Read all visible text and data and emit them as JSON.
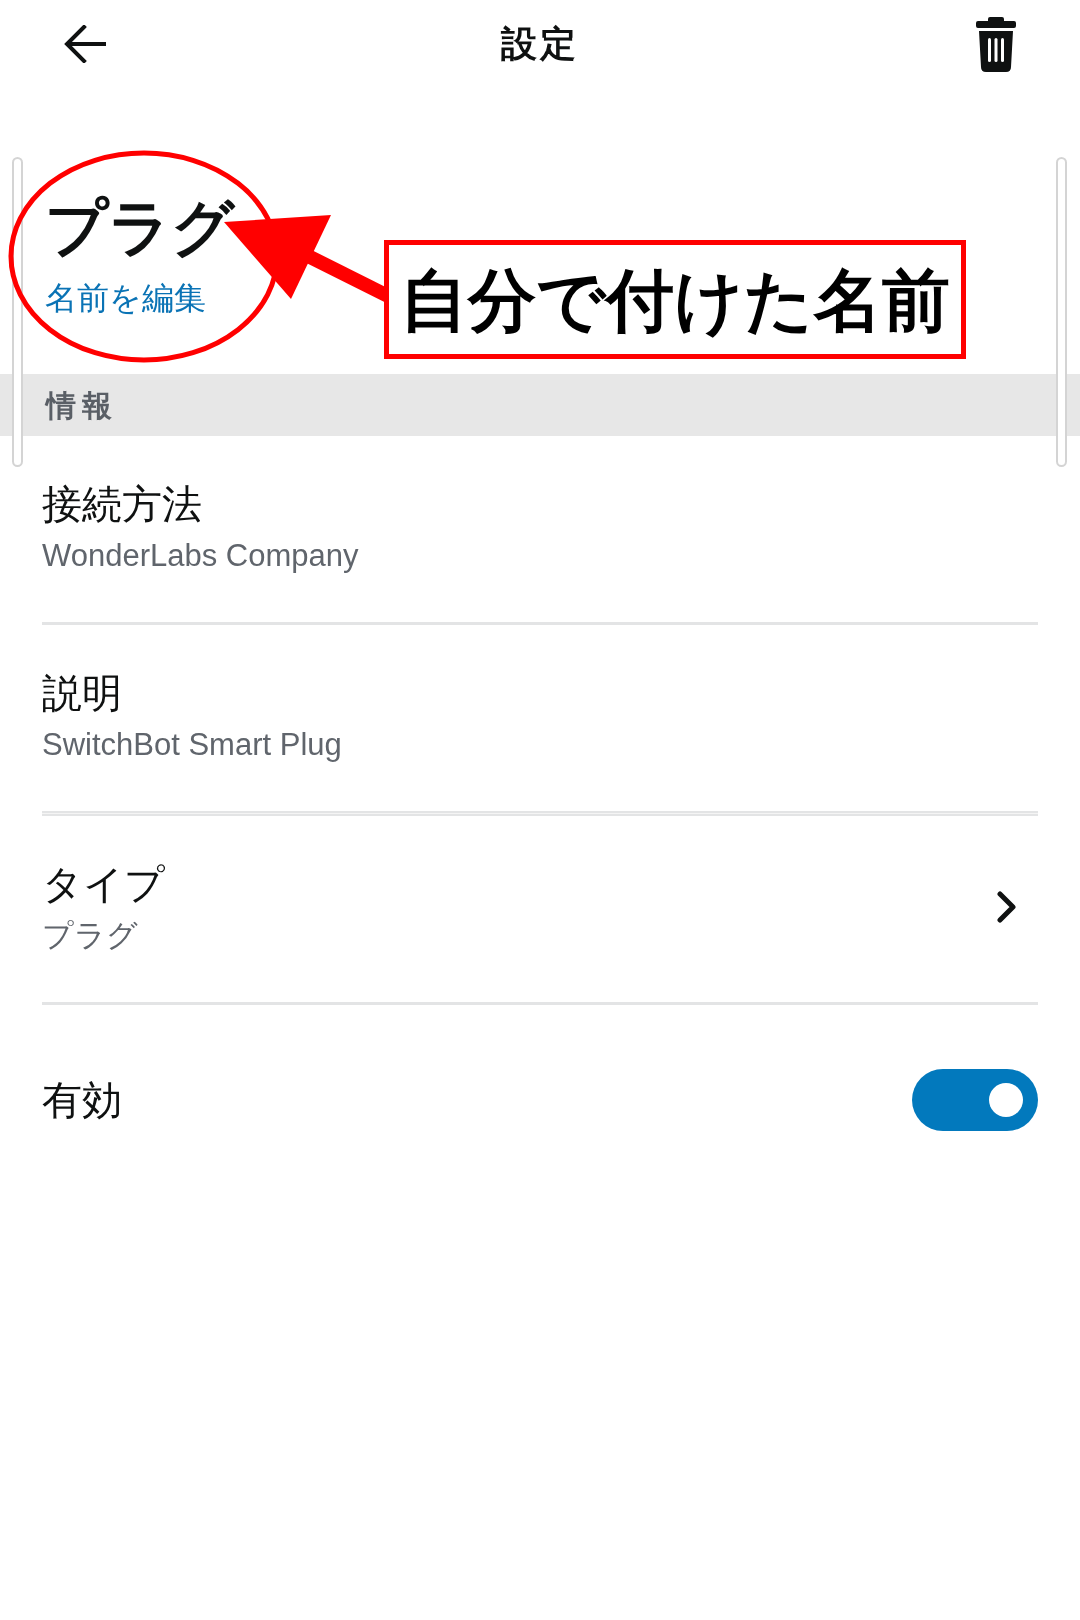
{
  "header": {
    "title": "設定"
  },
  "device": {
    "name": "プラグ",
    "edit_link": "名前を編集"
  },
  "annotation": {
    "label": "自分で付けた名前"
  },
  "section": {
    "title": "情報"
  },
  "rows": [
    {
      "kind": "info",
      "label": "接続方法",
      "value": "WonderLabs Company"
    },
    {
      "kind": "info",
      "label": "説明",
      "value": "SwitchBot Smart Plug"
    },
    {
      "kind": "link",
      "label": "タイプ",
      "value": "プラグ"
    },
    {
      "kind": "toggle",
      "label": "有効",
      "on": true
    }
  ]
}
